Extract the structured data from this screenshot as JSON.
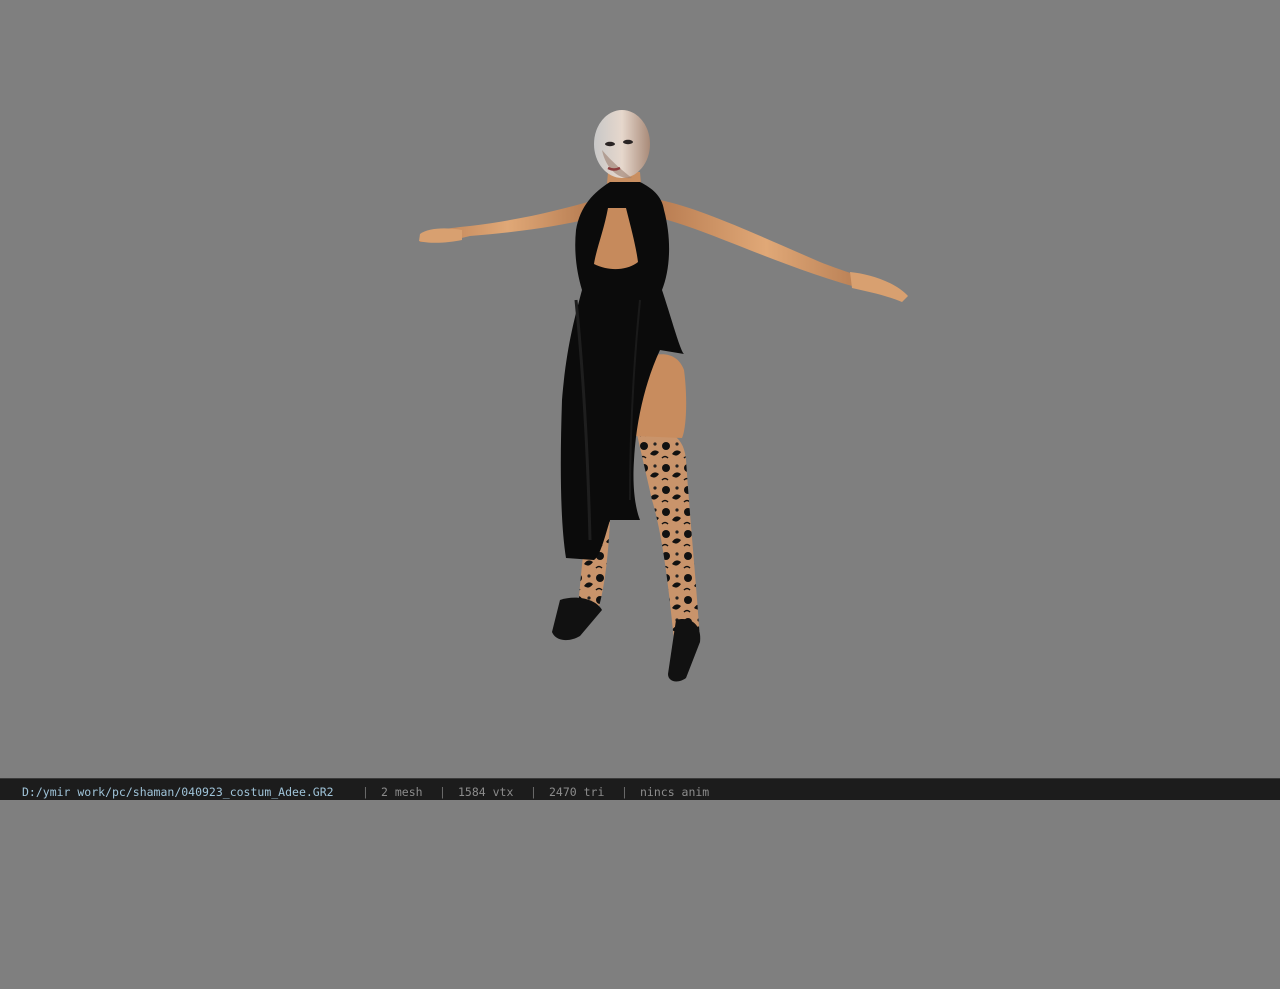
{
  "viewport": {
    "background_color": "#7f7f7f",
    "model": {
      "dress_color": "#0b0b0b",
      "skin_color": "#d49a6a",
      "stocking_color": "#c9946b",
      "icon": "character-model-icon"
    }
  },
  "statusbar": {
    "file_path": "D:/ymir work/pc/shaman/040923_costum_Adee.GR2",
    "separator": "|",
    "mesh_count": "2 mesh",
    "vertex_count": "1584 vtx",
    "triangle_count": "2470 tri",
    "anim_status": "nincs anim"
  }
}
